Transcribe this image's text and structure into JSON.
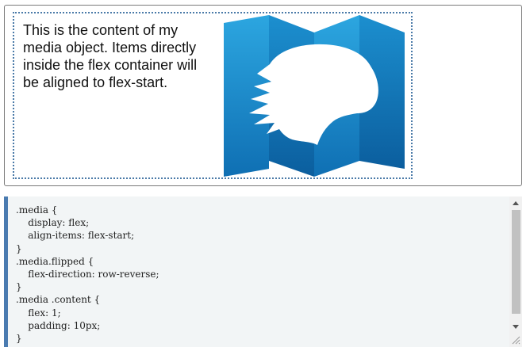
{
  "output": {
    "text": "This is the content of my media object. Items directly inside the flex container will be aligned to flex-start.",
    "image_icon": "bear-map-icon"
  },
  "code": {
    "lines": [
      ".media {",
      "    display: flex;",
      "    align-items: flex-start;",
      "}",
      ".media.flipped {",
      "    flex-direction: row-reverse;",
      "}",
      ".media .content {",
      "    flex: 1;",
      "    padding: 10px;",
      "}"
    ]
  },
  "colors": {
    "map_dark": "#0f6fb3",
    "map_light": "#2ca6e0",
    "code_border": "#4a7bb0",
    "code_background": "#f2f5f6",
    "media_border": "#4a7aa8"
  }
}
